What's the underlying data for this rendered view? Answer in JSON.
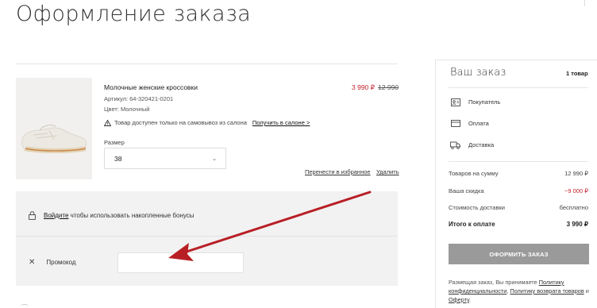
{
  "page": {
    "title": "Оформление заказа"
  },
  "product": {
    "name": "Молочные женские кроссовки",
    "price_new": "3 990 ₽",
    "price_old": "12 990",
    "article": "Артикул: 64-320421-0201",
    "color": "Цвет: Молочный",
    "pickup_warning": "Товар доступен только на самовывоз из салона",
    "pickup_link": "Получить в салоне >",
    "size_label": "Размер",
    "size_value": "38",
    "move_to_favorites": "Перенести в избранное",
    "remove": "Удалить"
  },
  "bonus": {
    "link": "Войдите",
    "text": " чтобы использовать накопленные бонусы"
  },
  "promo": {
    "label": "Промокод",
    "value": ""
  },
  "summary": {
    "title": "Ваш заказ",
    "count": "1 товар",
    "steps": [
      "Покупатель",
      "Оплата",
      "Доставка"
    ],
    "lines": [
      {
        "label": "Товаров на сумму",
        "value": "12 990 ₽"
      },
      {
        "label": "Ваша скидка",
        "value": "−9 000 ₽"
      },
      {
        "label": "Стоимость доставки",
        "value": "бесплатно"
      }
    ],
    "total_label": "Итого к оплате",
    "total_value": "3 990 ₽",
    "order_button": "Оформить заказ",
    "legal_prefix": "Размещая заказ, Вы принимаете ",
    "legal_link1": "Политику конфиденциальности",
    "legal_mid": ", ",
    "legal_link2": "Политику возврата товаров",
    "legal_and": " и ",
    "legal_link3": "Оферту",
    "legal_end": "."
  },
  "colors": {
    "accent_red": "#c4202c",
    "annotation_arrow": "#b81f25",
    "button_gray": "#9a9a9a"
  },
  "icons": [
    "warning-icon",
    "chevron-down-icon",
    "lock-icon",
    "close-icon",
    "person-card-icon",
    "payment-card-icon",
    "truck-icon",
    "annotation-arrow"
  ]
}
